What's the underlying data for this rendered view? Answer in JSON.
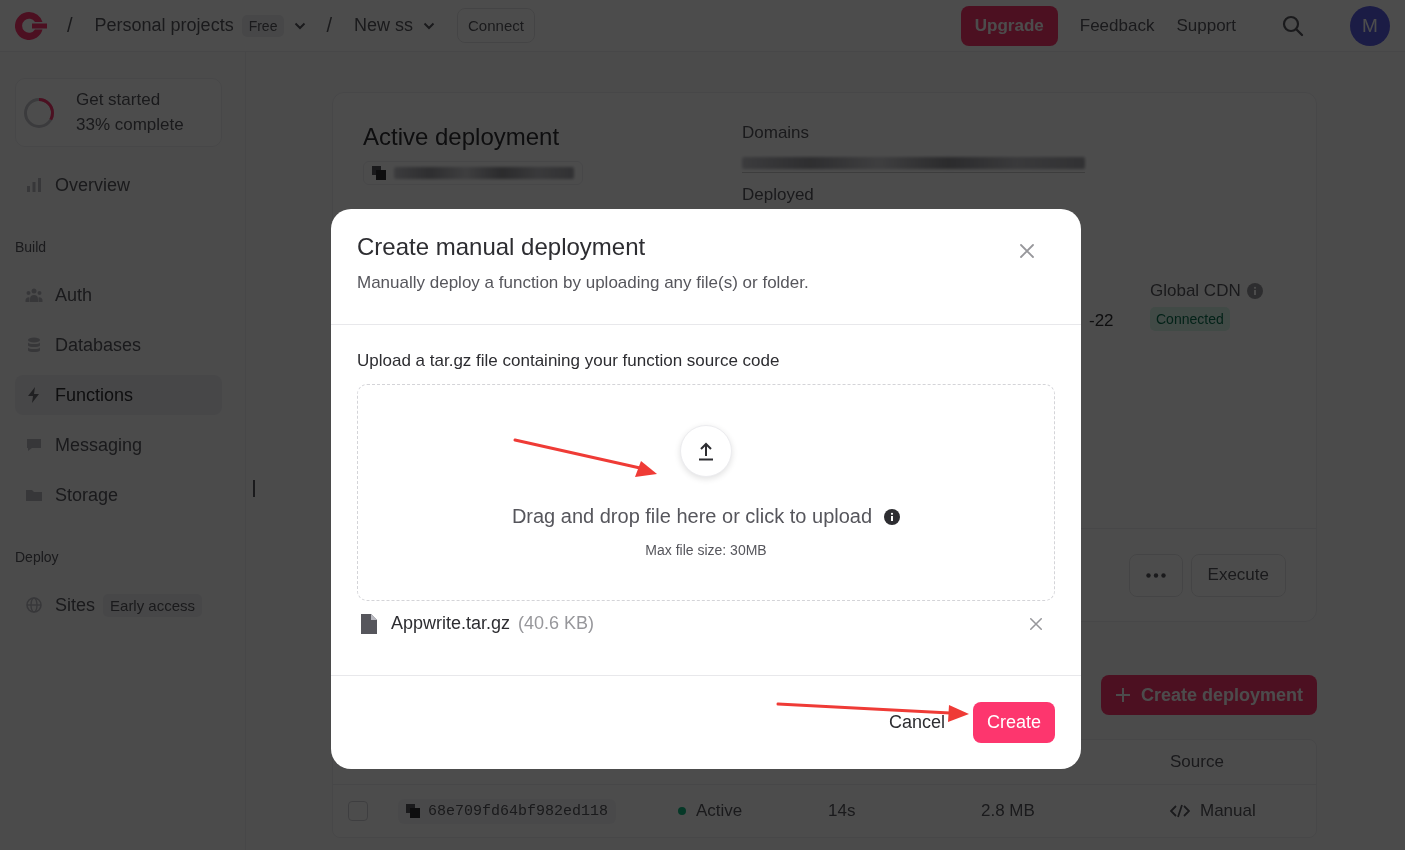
{
  "topbar": {
    "breadcrumbs": [
      {
        "separator": "/",
        "label": "Personal projects",
        "badge": "Free"
      },
      {
        "separator": "/",
        "label": "New ss"
      }
    ],
    "connect": "Connect",
    "upgrade": "Upgrade",
    "links": [
      "Feedback",
      "Support"
    ],
    "avatar": "M"
  },
  "sidebar": {
    "progress": {
      "title": "Get started",
      "subtitle": "33% complete",
      "level": 0.33
    },
    "sections": [
      {
        "items": [
          {
            "label": "Overview",
            "selected": false
          }
        ]
      },
      {
        "heading": "Build",
        "items": [
          {
            "label": "Auth",
            "selected": false
          },
          {
            "label": "Databases",
            "selected": false
          },
          {
            "label": "Functions",
            "selected": true
          },
          {
            "label": "Messaging",
            "selected": false
          },
          {
            "label": "Storage",
            "selected": false
          }
        ]
      },
      {
        "heading": "Deploy",
        "items": [
          {
            "label": "Sites",
            "selected": false,
            "badge": "Early access"
          }
        ]
      }
    ]
  },
  "deployment": {
    "title": "Active deployment",
    "domains_label": "Domains",
    "deployed_label": "Deployed",
    "date_fragment": "-22",
    "cdn_label": "Global CDN",
    "cdn_status": "Connected",
    "actions": [
      "Execute"
    ]
  },
  "create_button": "Create deployment",
  "table": {
    "columns": [
      "",
      "",
      "",
      "",
      "",
      "Source"
    ],
    "rows": [
      {
        "selected": false,
        "id": "68e709fd64bf982ed118",
        "status": "Active",
        "duration": "14s",
        "size": "2.8 MB",
        "source": "Manual"
      }
    ]
  },
  "modal": {
    "title": "Create manual deployment",
    "description": "Manually deploy a function by uploading any file(s) or folder.",
    "upload_label": "Upload a tar.gz file containing your function source code",
    "dropzone": {
      "text": "Drag and drop file here or click to upload",
      "hint": "Max file size: 30MB"
    },
    "file": {
      "name": "Appwrite.tar.gz",
      "size": "(40.6 KB)"
    },
    "buttons": [
      {
        "label": "Cancel",
        "kind": "secondary"
      },
      {
        "label": "Create",
        "kind": "primary"
      }
    ]
  }
}
